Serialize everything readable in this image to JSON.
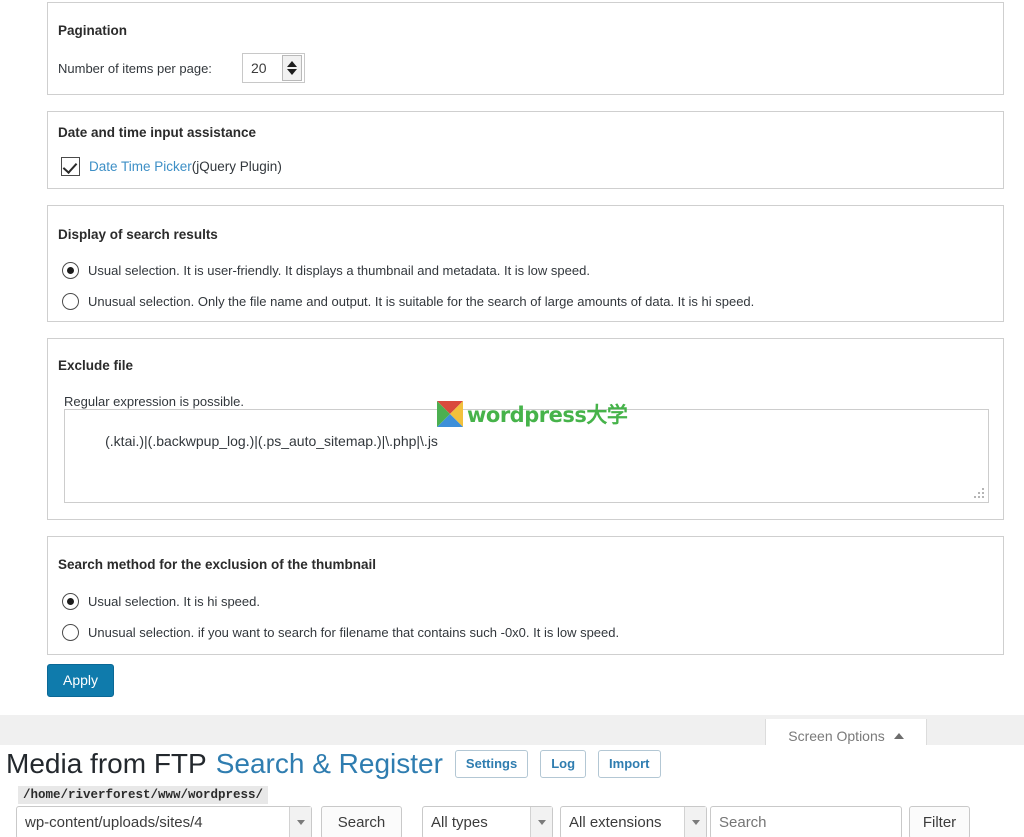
{
  "screen_options": {
    "pagination": {
      "title": "Pagination",
      "label": "Number of items per page:",
      "value": "20"
    },
    "datetime": {
      "title": "Date and time input assistance",
      "link_label": "Date Time Picker",
      "suffix_label": "(jQuery Plugin)",
      "checked": true
    },
    "display_results": {
      "title": "Display of search results",
      "options": [
        {
          "label": "Usual selection. It is user-friendly. It displays a thumbnail and metadata. It is low speed.",
          "selected": true
        },
        {
          "label": "Unusual selection. Only the file name and output. It is suitable for the search of large amounts of data. It is hi speed.",
          "selected": false
        }
      ]
    },
    "exclude_file": {
      "title": "Exclude file",
      "hint": "Regular expression is possible.",
      "value": "(.ktai.)|(.backwpup_log.)|(.ps_auto_sitemap.)|\\.php|\\.js"
    },
    "search_method": {
      "title": "Search method for the exclusion of the thumbnail",
      "options": [
        {
          "label": "Usual selection. It is hi speed.",
          "selected": true
        },
        {
          "label": "Unusual selection. if you want to search for filename that contains such -0x0. It is low speed.",
          "selected": false
        }
      ]
    },
    "apply_label": "Apply",
    "tab_label": "Screen Options"
  },
  "page": {
    "title_main": "Media from FTP",
    "title_sub": "Search & Register",
    "nav_buttons": [
      "Settings",
      "Log",
      "Import"
    ]
  },
  "toolbar": {
    "path_label": "/home/riverforest/www/wordpress/",
    "directory_value": "wp-content/uploads/sites/4",
    "search_button": "Search",
    "type_value": "All types",
    "extension_value": "All extensions",
    "search_placeholder": "Search",
    "filter_button": "Filter"
  },
  "watermark": {
    "text": "wordpress大学"
  },
  "colors": {
    "accent_blue": "#2f7db0",
    "apply_blue": "#0f7bac",
    "link_blue": "#3d8fc6",
    "panel_border": "#cfcfcf",
    "band_gray": "#f0f0f0"
  }
}
